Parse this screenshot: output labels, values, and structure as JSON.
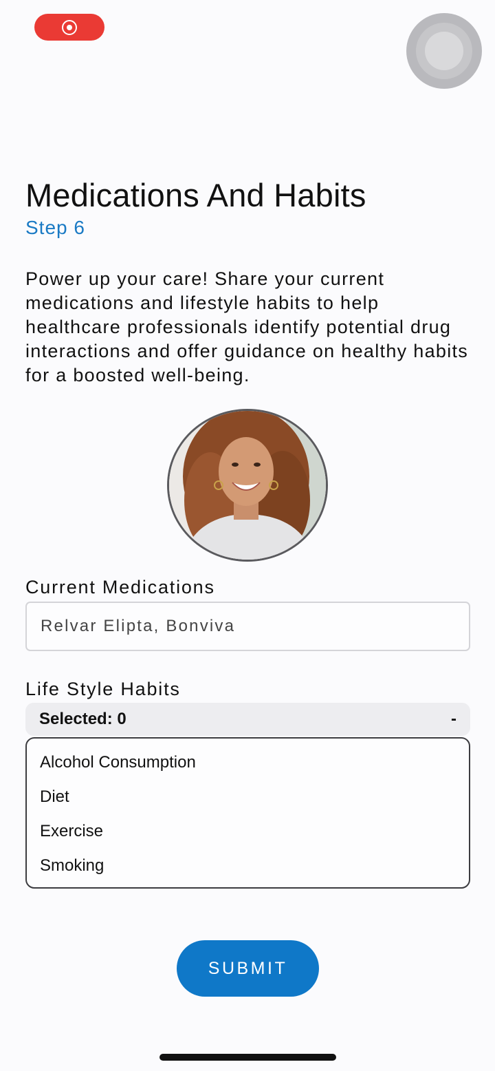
{
  "status_bar": {
    "recording_indicator": "record-icon",
    "assistive_touch": "assistive-touch-icon"
  },
  "header": {
    "title": "Medications And Habits",
    "step": "Step 6"
  },
  "intro_text": "Power up your care! Share your current medications and lifestyle habits to help healthcare professionals identify potential drug interactions and offer guidance on healthy habits for a boosted well-being.",
  "medications": {
    "label": "Current Medications",
    "value": "Relvar Elipta, Bonviva"
  },
  "habits": {
    "label": "Life Style Habits",
    "selected_text": "Selected: 0",
    "toggle_symbol": "-",
    "options": [
      "Alcohol Consumption",
      "Diet",
      "Exercise",
      "Smoking"
    ]
  },
  "submit": {
    "label": "SUBMIT"
  },
  "colors": {
    "accent": "#1a7ac4",
    "button": "#0f78c8",
    "record": "#ea3a34"
  }
}
